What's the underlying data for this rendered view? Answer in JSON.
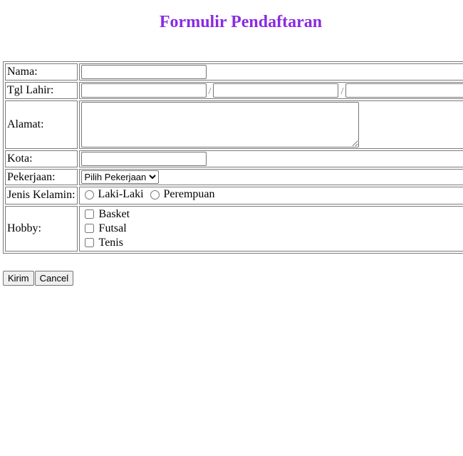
{
  "page_title": "Formulir Pendaftaran",
  "accent_color": "#8a2be2",
  "form": {
    "nama_label": "Nama:",
    "nama_value": "",
    "tgl_label": "Tgl Lahir:",
    "tgl_separator": "/",
    "tgl_day": "",
    "tgl_month": "",
    "tgl_year": "",
    "alamat_label": "Alamat:",
    "alamat_value": "",
    "kota_label": "Kota:",
    "kota_value": "",
    "pekerjaan_label": "Pekerjaan:",
    "pekerjaan_selected": "Pilih Pekerjaan",
    "jk_label": "Jenis Kelamin:",
    "jk_options": [
      "Laki-Laki",
      "Perempuan"
    ],
    "hobby_label": "Hobby:",
    "hobbies": [
      "Basket",
      "Futsal",
      "Tenis"
    ]
  },
  "buttons": {
    "submit": "Kirim",
    "cancel": "Cancel"
  }
}
